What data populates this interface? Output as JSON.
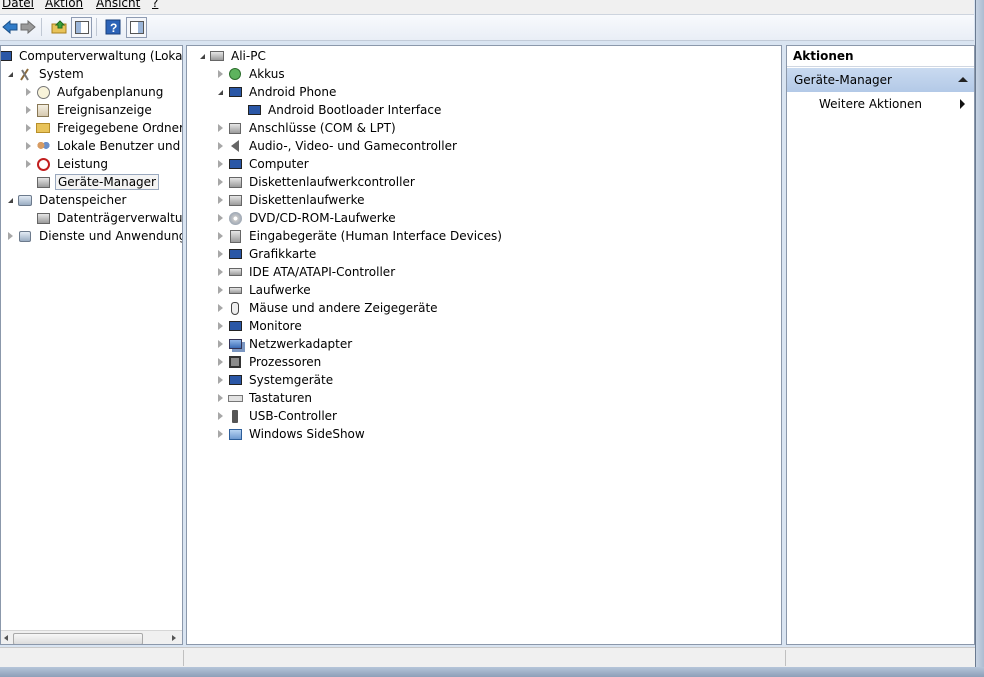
{
  "menu": {
    "items": [
      "Datei",
      "Aktion",
      "Ansicht",
      "?"
    ]
  },
  "toolbar": {
    "buttons": [
      "back-arrow-icon",
      "forward-arrow-icon",
      "up-folder-icon",
      "show-hide-tree-icon",
      "help-icon",
      "show-hide-action-pane-icon"
    ]
  },
  "left_tree": {
    "root": "Computerverwaltung (Lokal)",
    "system": "System",
    "system_children": [
      "Aufgabenplanung",
      "Ereignisanzeige",
      "Freigegebene Ordner",
      "Lokale Benutzer und Gr",
      "Leistung",
      "Geräte-Manager"
    ],
    "storage": "Datenspeicher",
    "storage_children": [
      "Datenträgerverwaltung"
    ],
    "services": "Dienste und Anwendungen"
  },
  "device_tree": {
    "root": "Ali-PC",
    "items": [
      "Akkus",
      "Android Phone",
      "Android Bootloader Interface",
      "Anschlüsse (COM & LPT)",
      "Audio-, Video- und Gamecontroller",
      "Computer",
      "Diskettenlaufwerkcontroller",
      "Diskettenlaufwerke",
      "DVD/CD-ROM-Laufwerke",
      "Eingabegeräte (Human Interface Devices)",
      "Grafikkarte",
      "IDE ATA/ATAPI-Controller",
      "Laufwerke",
      "Mäuse und andere Zeigegeräte",
      "Monitore",
      "Netzwerkadapter",
      "Prozessoren",
      "Systemgeräte",
      "Tastaturen",
      "USB-Controller",
      "Windows SideShow"
    ]
  },
  "actions": {
    "title": "Aktionen",
    "section": "Geräte-Manager",
    "more": "Weitere Aktionen"
  },
  "colors": {
    "selection_border": "#9aa9bf",
    "actions_header": "#c9daf0"
  }
}
